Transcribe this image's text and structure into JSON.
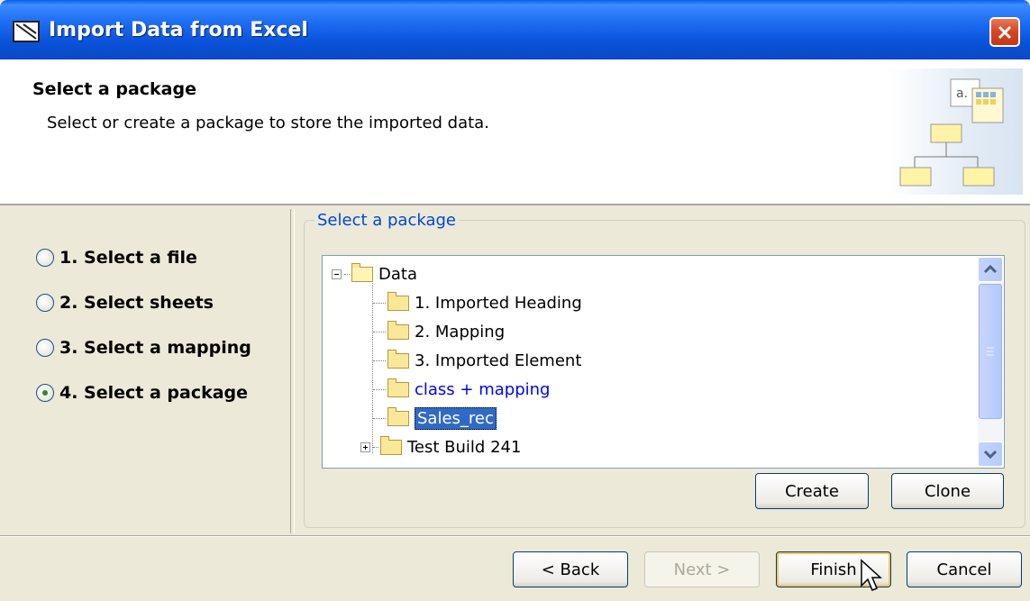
{
  "window": {
    "title": "Import Data from Excel",
    "icon": "app-icon"
  },
  "header": {
    "title": "Select a package",
    "description": "Select or create a package to store the imported data."
  },
  "steps": [
    {
      "label": "1. Select a file",
      "selected": false
    },
    {
      "label": "2. Select sheets",
      "selected": false
    },
    {
      "label": "3. Select a mapping",
      "selected": false
    },
    {
      "label": "4. Select a package",
      "selected": true
    }
  ],
  "package_group": {
    "legend": "Select a package",
    "tree": {
      "root": "Data",
      "children": [
        {
          "label": "1. Imported Heading"
        },
        {
          "label": "2. Mapping"
        },
        {
          "label": "3. Imported Element"
        },
        {
          "label": "class + mapping",
          "style": "link"
        },
        {
          "label": "Sales_rec",
          "selected": true
        },
        {
          "label": "Test Build 241",
          "expandable": true
        }
      ]
    },
    "create_label": "Create",
    "clone_label": "Clone"
  },
  "footer": {
    "back_label": "< Back",
    "next_label": "Next >",
    "finish_label": "Finish",
    "cancel_label": "Cancel"
  },
  "colors": {
    "titlebar": "#0a53da",
    "legend": "#0046d5",
    "selection": "#316ac5"
  }
}
